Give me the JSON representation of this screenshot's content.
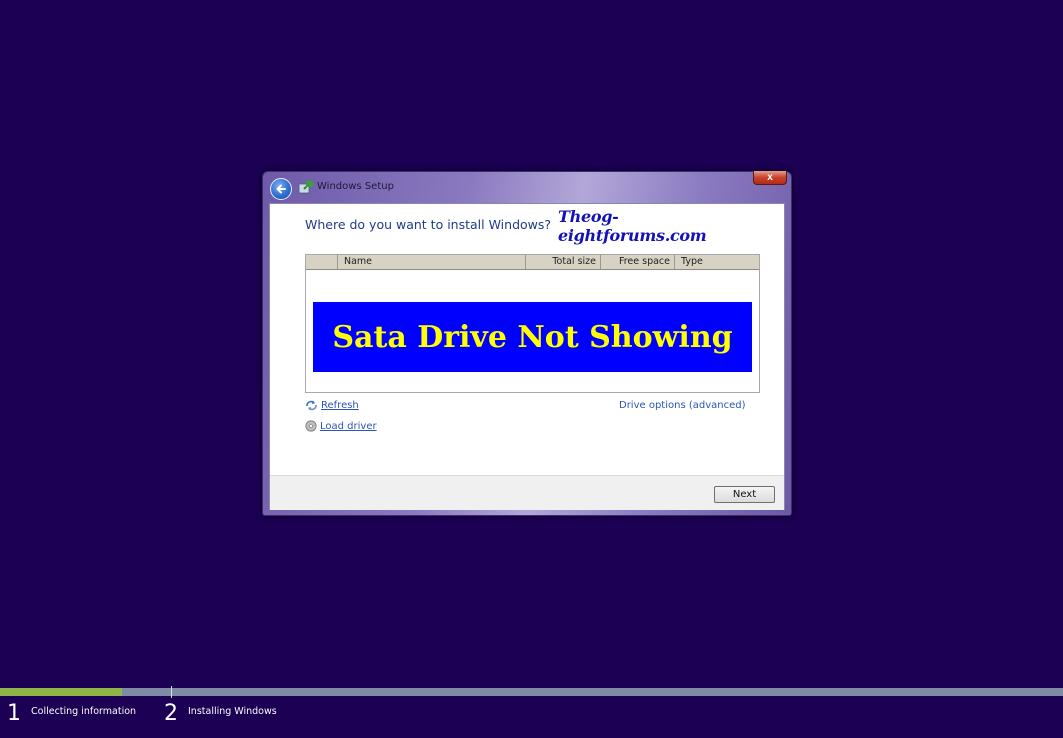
{
  "window": {
    "title": "Windows Setup",
    "close_label": "x",
    "question": "Where do you want to install Windows?",
    "watermark": "Theog-eightforums.com"
  },
  "list": {
    "columns": [
      "Name",
      "Total size",
      "Free space",
      "Type"
    ],
    "banner": "Sata Drive Not Showing"
  },
  "links": {
    "refresh": "Refresh",
    "load_driver": "Load driver",
    "drive_options": "Drive options (advanced)"
  },
  "buttons": {
    "next": "Next"
  },
  "progress": {
    "fill_fraction": 0.115,
    "steps": [
      {
        "number": "1",
        "label": "Collecting information"
      },
      {
        "number": "2",
        "label": "Installing Windows"
      }
    ]
  },
  "colors": {
    "background": "#1c0053",
    "banner_bg": "#0000ff",
    "banner_text": "#ffff00",
    "link": "#2a55b5",
    "progress_fill": "#8fb547"
  },
  "icons": {
    "back": "back-arrow-icon",
    "setup": "windows-setup-icon",
    "refresh": "refresh-icon",
    "load_driver": "disc-icon"
  }
}
